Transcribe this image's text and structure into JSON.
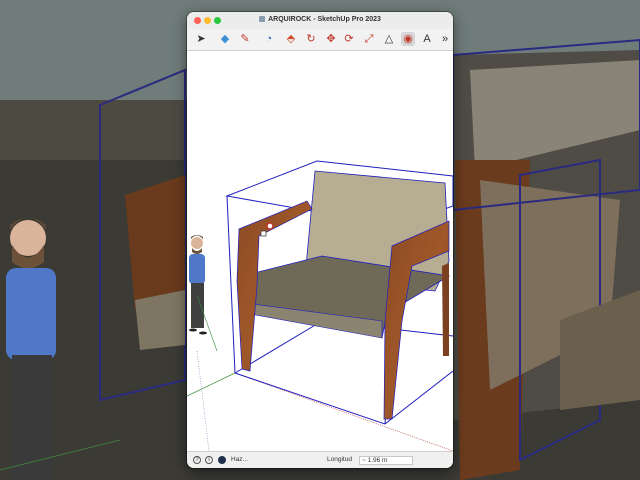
{
  "window": {
    "title": "ARQUIROCK - SketchUp Pro 2023"
  },
  "toolbar": {
    "tools": [
      {
        "name": "select-tool",
        "glyph": "➤"
      },
      {
        "name": "eraser-tool",
        "glyph": "◆"
      },
      {
        "name": "pencil-tool",
        "glyph": "✎"
      },
      {
        "name": "arc-tool",
        "glyph": "◔"
      },
      {
        "name": "push-pull-tool",
        "glyph": "⬘"
      },
      {
        "name": "rotate-tool",
        "glyph": "↻"
      },
      {
        "name": "move-tool",
        "glyph": "✥"
      },
      {
        "name": "follow-me-tool",
        "glyph": "⟳"
      },
      {
        "name": "scale-tool",
        "glyph": "⤢"
      },
      {
        "name": "tape-measure-tool",
        "glyph": "△"
      },
      {
        "name": "paint-tool",
        "glyph": "◉"
      },
      {
        "name": "text-tool",
        "glyph": "A"
      },
      {
        "name": "more-tools",
        "glyph": "»"
      }
    ]
  },
  "status": {
    "hint": "Haz...",
    "length_label": "Longitud",
    "length_value": "~ 1.96 m"
  }
}
